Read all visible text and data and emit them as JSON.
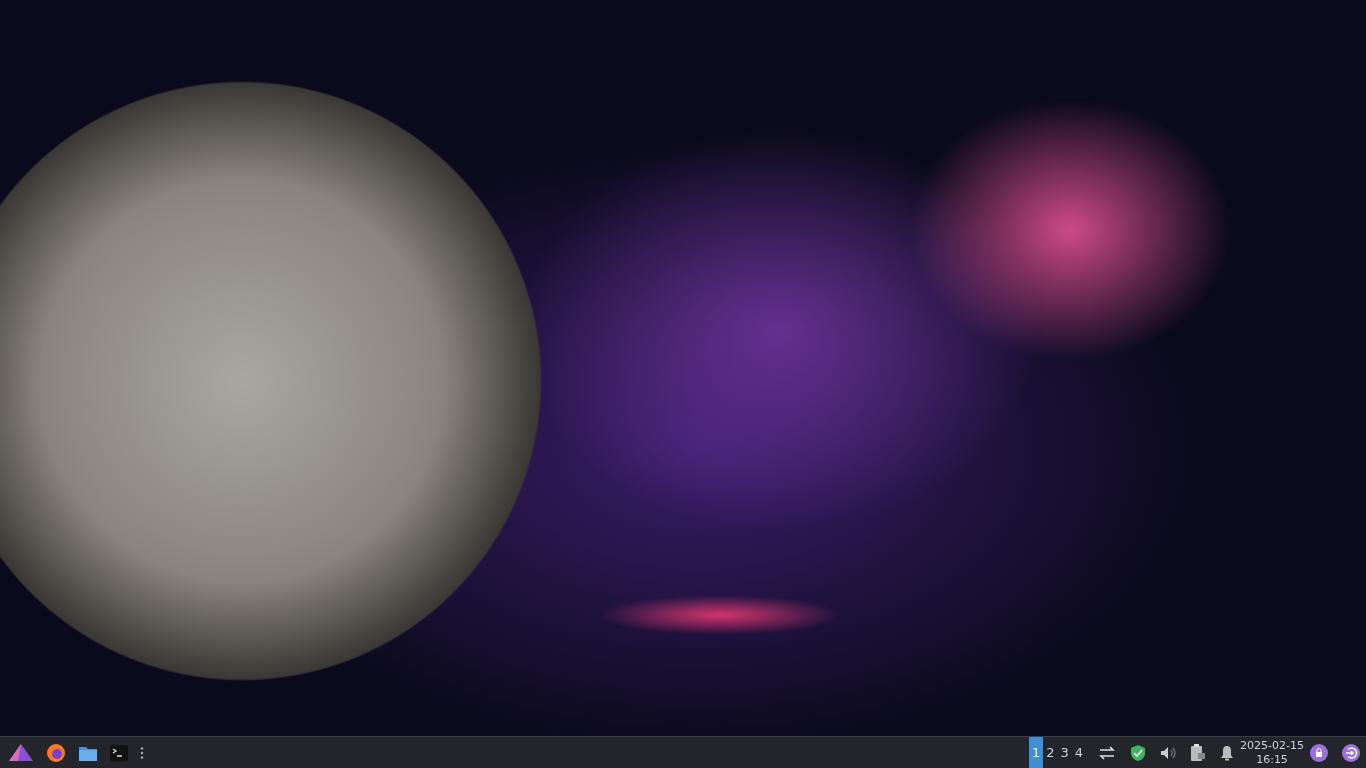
{
  "panel": {
    "desktops": [
      {
        "label": "1",
        "selected": true
      },
      {
        "label": "2",
        "selected": false
      },
      {
        "label": "3",
        "selected": false
      },
      {
        "label": "4",
        "selected": false
      }
    ],
    "clock": {
      "date": "2025-02-15",
      "time": "16:15"
    }
  }
}
